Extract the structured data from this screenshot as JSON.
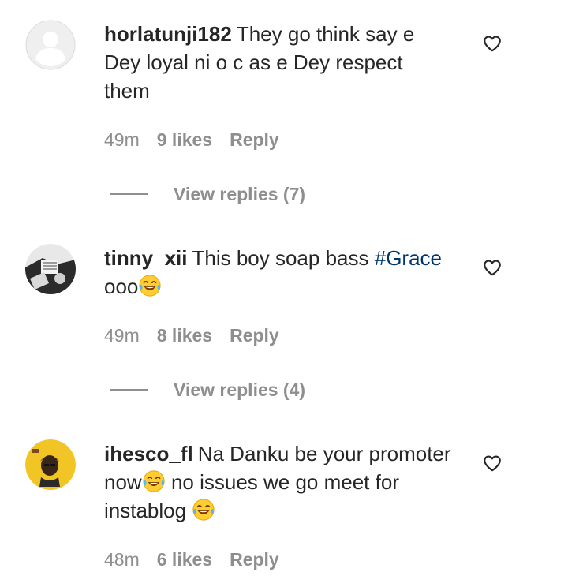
{
  "comments": [
    {
      "username": "horlatunji182",
      "text": "They go think say e Dey loyal ni o c as e Dey respect them",
      "time": "49m",
      "likes": "9 likes",
      "reply_label": "Reply",
      "view_replies": "View replies (7)",
      "avatar_icon": "default-avatar-icon"
    },
    {
      "username": "tinny_xii",
      "text_before": "This boy soap bass",
      "hashtag": "#Grace",
      "text_after": "ooo",
      "time": "49m",
      "likes": "8 likes",
      "reply_label": "Reply",
      "view_replies": "View replies (4)",
      "avatar_icon": "photo-avatar-icon"
    },
    {
      "username": "ihesco_fl",
      "text_1": "Na Danku be your promoter now",
      "text_2": "no issues we go meet for instablog",
      "time": "48m",
      "likes": "6 likes",
      "reply_label": "Reply",
      "avatar_icon": "illustrated-avatar-icon"
    }
  ],
  "colors": {
    "text": "#262626",
    "secondary": "#8e8e8e",
    "hashtag": "#00376b",
    "avatar_yellow": "#f2c526"
  }
}
